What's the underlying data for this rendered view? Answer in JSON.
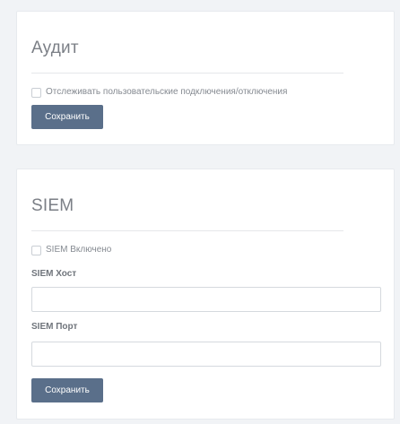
{
  "audit": {
    "title": "Аудит",
    "track_connections_label": "Отслеживать пользовательские подключения/отключения",
    "track_connections_checked": false,
    "save_label": "Сохранить"
  },
  "siem": {
    "title": "SIEM",
    "enabled_label": "SIEM Включено",
    "enabled_checked": false,
    "host_label": "SIEM Хост",
    "host_value": "",
    "port_label": "SIEM Порт",
    "port_value": "",
    "save_label": "Сохранить"
  },
  "colors": {
    "button": "#5a6f8a",
    "background": "#f1f3f6",
    "card": "#ffffff"
  }
}
